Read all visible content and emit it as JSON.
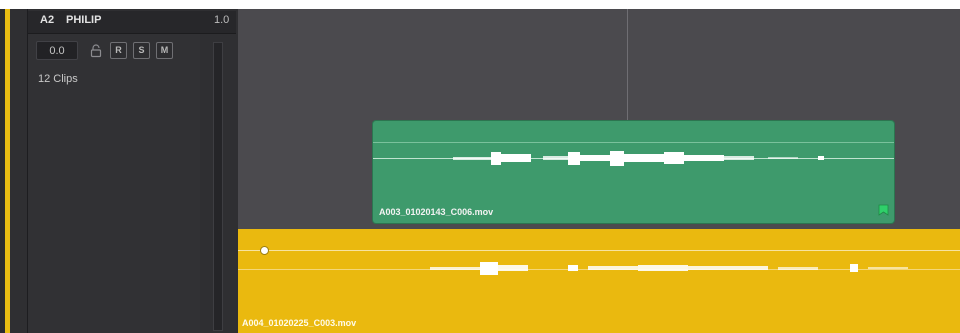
{
  "track": {
    "id": "A2",
    "name": "PHILIP",
    "level": "1.0",
    "volume": "0.0",
    "clips_count": "12 Clips",
    "buttons": {
      "record": "R",
      "solo": "S",
      "mute": "M"
    }
  },
  "clips": {
    "upper": {
      "name": "A003_01020143_C006.mov",
      "color": "#3e9a6c"
    },
    "lower": {
      "name": "A004_01020225_C003.mov",
      "color": "#eab90f"
    }
  },
  "icons": {
    "lock": "lock-icon",
    "flag": "flag-icon",
    "keyframe": "keyframe-icon"
  },
  "colors": {
    "track_accent": "#e9bc12",
    "timeline_bg": "#4b4a4e",
    "header_bg": "#2f2f32"
  }
}
